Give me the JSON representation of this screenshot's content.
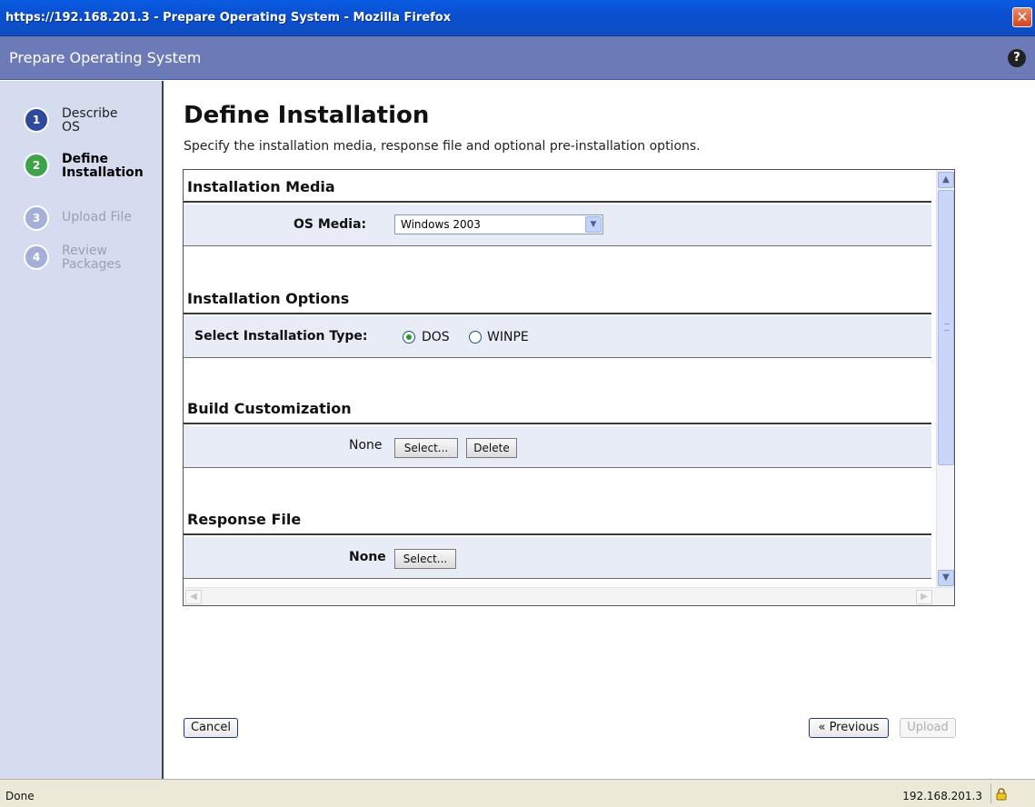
{
  "window": {
    "title": "https://192.168.201.3 - Prepare Operating System - Mozilla Firefox",
    "close_glyph": "✕"
  },
  "app": {
    "title": "Prepare Operating System",
    "help_glyph": "?"
  },
  "steps": [
    {
      "num": "1",
      "label": "Describe OS",
      "state": "done"
    },
    {
      "num": "2",
      "label": "Define Installation",
      "state": "current"
    },
    {
      "num": "3",
      "label": "Upload File",
      "state": "pending"
    },
    {
      "num": "4",
      "label": "Review Packages",
      "state": "pending"
    }
  ],
  "main": {
    "title": "Define Installation",
    "subtitle": "Specify the installation media, response file and optional pre-installation options."
  },
  "sections": {
    "media": {
      "heading": "Installation Media",
      "os_media_label": "OS Media:",
      "os_media_value": "Windows 2003"
    },
    "options": {
      "heading": "Installation Options",
      "type_label": "Select Installation Type:",
      "type_options": [
        "DOS",
        "WINPE"
      ],
      "selected": "DOS"
    },
    "build": {
      "heading": "Build Customization",
      "value": "None",
      "select_button": "Select...",
      "delete_button": "Delete"
    },
    "response": {
      "heading": "Response File",
      "value": "None",
      "select_button": "Select..."
    }
  },
  "footer": {
    "cancel": "Cancel",
    "previous": "« Previous",
    "upload": "Upload"
  },
  "statusbar": {
    "status": "Done",
    "host": "192.168.201.3"
  },
  "colors": {
    "titlebar": "#0a4fd0",
    "app_header": "#6d7ab8",
    "sidebar": "#d5dcf0",
    "row_background": "#e8ecf6",
    "step_done": "#2f4a9c",
    "step_current": "#3ea24a",
    "step_pending": "#a5b0d8"
  },
  "icons": [
    "close-icon",
    "help-icon",
    "dropdown-arrow-icon",
    "scroll-up-icon",
    "scroll-down-icon",
    "scroll-left-icon",
    "scroll-right-icon",
    "lock-icon"
  ]
}
